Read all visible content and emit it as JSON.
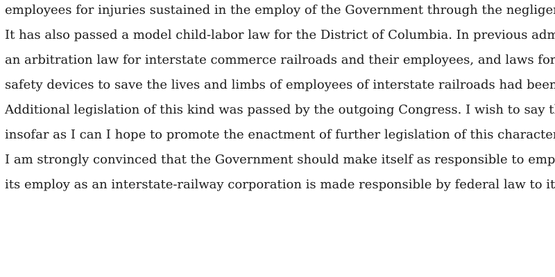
{
  "document": {
    "lines": [
      "employees for injuries sustained in the employ of the Government through the negligence of",
      "It has also passed a model child-labor law for the District of Columbia. In previous administ",
      "an arbitration law for interstate commerce railroads and their employees, and laws for the a",
      "safety devices to save the lives and limbs of employees of interstate railroads had been passe",
      "Additional legislation of this kind was passed by the outgoing Congress. I wish to say that",
      "insofar as I can I hope to promote the enactment of further legislation of this character.",
      "I am strongly convinced that the Government should make itself as responsible to employees",
      "its employ as an interstate-railway corporation is made responsible by federal law to its emp"
    ]
  }
}
